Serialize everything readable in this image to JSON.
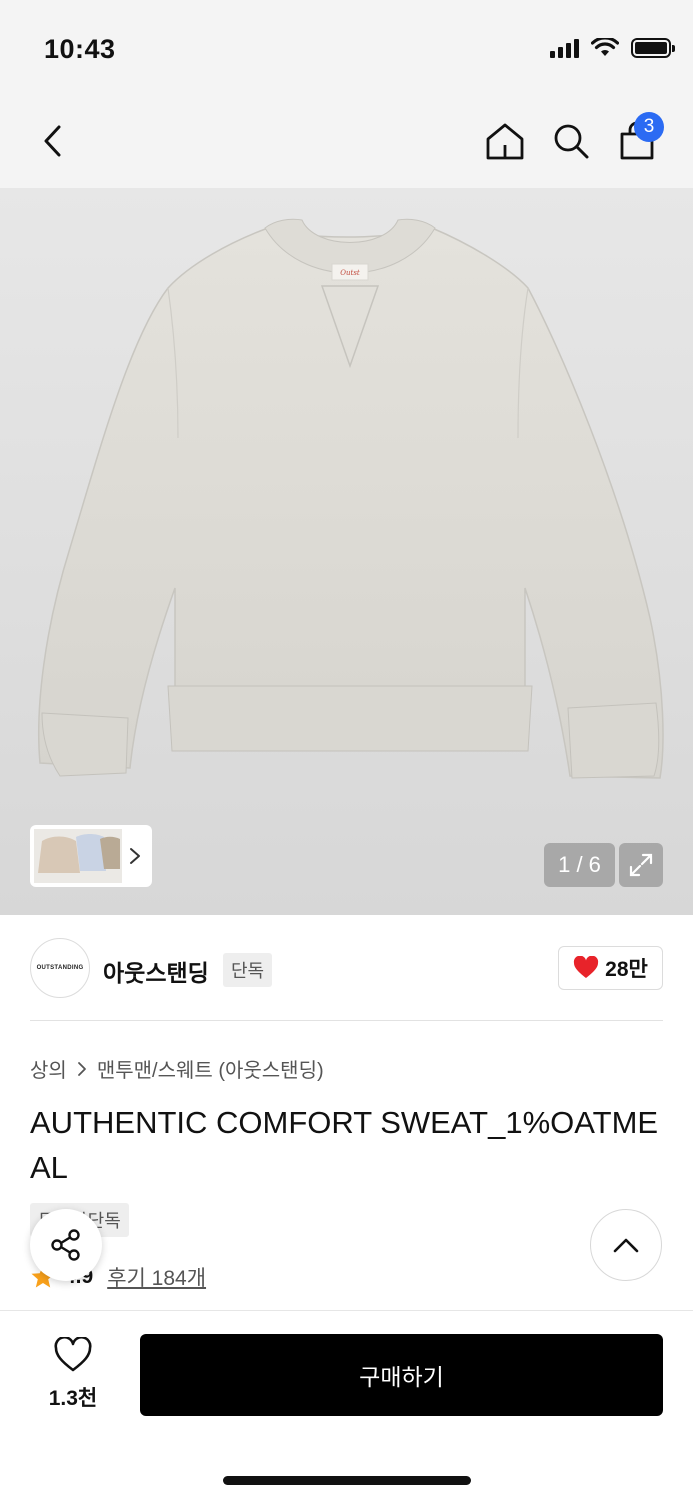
{
  "status_bar": {
    "time": "10:43"
  },
  "nav": {
    "cart_count": "3"
  },
  "gallery": {
    "page_indicator": "1 / 6"
  },
  "brand": {
    "logo_text": "OUTSTANDING",
    "name": "아웃스탠딩",
    "tag": "단독",
    "like_count": "28만"
  },
  "breadcrumb": {
    "category": "상의",
    "subcategory": "맨투맨/스웨트 (아웃스탠딩)"
  },
  "product": {
    "title": "AUTHENTIC COMFORT SWEAT_1%OATMEAL",
    "exclusive_tag": "무신사단독",
    "rating": "4.9",
    "reviews": "후기 184개"
  },
  "bottom_bar": {
    "wish_count": "1.3천",
    "buy_label": "구매하기"
  },
  "colors": {
    "accent_blue": "#2b6bf3",
    "heart_red": "#e8232a",
    "star_orange": "#f9a11b",
    "buy_black": "#000000"
  }
}
